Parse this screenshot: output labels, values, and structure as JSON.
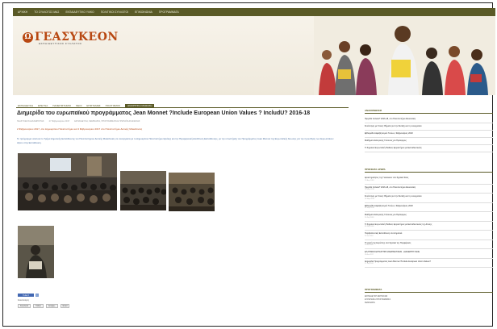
{
  "nav": {
    "items": [
      "ΑΡΧΙΚΗ",
      "ΤΟ ΣΥΛΛΟΓΟΣ ΜΑΣ",
      "ΕΚΠΑΙΔΕΥΤΙΚΟ ΥΛΙΚΟ",
      "ΠΟΛΙΤΙΚΟΙ ΣΥΛΛΟΓΟΙ",
      "ΕΠΙΚΟΙΝΩΝΙΑ",
      "ΠΡΟΓΡΑΜΜΑΤΑ"
    ]
  },
  "header": {
    "logo_mark": "Ω",
    "logo_name": "ΓΕΑΣΥΚΕΟΝ",
    "logo_tagline": "ΕΚΠΑΙΔΕΥΤΙΚΟΣ ΣΥΛΛΟΓΟΣ"
  },
  "tabs": [
    "ΕΚΠΑΙΔΕΥΣΗ",
    "ΕΡΕΥΝΑ",
    "ΠΑΝΕΠΙΣΤΗΜΙΟ",
    "ΝΕΟΙ",
    "ΕΠΙΣΤΗΜΕΣ",
    "ΠΟΛΙΤΙΣΜΟΣ",
    "ΔΙΑΚΡΙΤΙΚΗ ΜΑΘΗΣΗ"
  ],
  "article": {
    "title": "Διημερίδα του ευρωπαϊκού προγράμματος Jean Monnet ?Include European Union Values ? IncludU? 2016-18",
    "meta_author": "ΓΕΑΣΥΚΕΟΝ ΔΙΑΧΕΙΡΙΣΤΗΣ",
    "meta_date": "27 Φεβρουαρίου 2017",
    "meta_category": "ΕΚΠΑΙΔΕΥΣΗ, ΣΕΜΙΝΑΡΙΑ, ΠΡΟΓΡΑΜΜΑΤΑ ΕΥΡΩΠΑΪΚΗΣ ΕΝΩΣΗΣ",
    "lead": "2 Φεβρουαρίου 2017, στο Δημοκρίτειο Πανεπιστήμιο και 3 Φεβρουαρίου 2017 στο Πανεπιστήμιο Δυτικής Μακεδονίας",
    "paragraph": "Το πρόγραμμα υλοποιεί το Τμήμα Δημοτικής Εκπαίδευσης του Πανεπιστημίου Δυτικής Μακεδονίας σε συνεργασία με το Δημοκρίτειο Πανεπιστήμιο Θράκης και την Περιφερειακή Διεύθυνση Εκπαίδευσης, με την υποστήριξη του Προγράμματος Jean Monnet της Ευρωπαϊκής Ένωσης για την προώθηση των Ευρωπαϊκών Αξιών στην Εκπαίδευση."
  },
  "share": {
    "facebook_label": "f Like 0",
    "twitter_label": "t",
    "heading": "Κοινοποίηση:",
    "buttons": [
      "Facebook",
      "Twitter",
      "Google+",
      "Email"
    ]
  },
  "sidebar": {
    "recent_heading": "ΑΝΑΚΟΙΝΩΣΕΙΣ",
    "recent": [
      "Ημερίδα Include? 2016-18, στο Πανεπιστήμιο Θεσσαλίας",
      "Συνάντηση με Γονείς: Βήματα για την Ένταξη και τη συνεργασία",
      "Εβδομάδα Αλφαβητισμού Γονέων, Φεβρουάριος 2018",
      "Μαθήματα Ελληνικής Γλώσσας για Πρόσφυγες",
      "Τι Σημαίνει Ευρωπαϊκή Παιδεία; Εργαστήριο για Εκπαιδευτικούς"
    ],
    "latest_heading": "ΠΡΟΣΦΑΤΑ ΑΡΘΡΑ",
    "latest": [
      {
        "t": "Δραστηριότητες της Γεασυκεον στο Σχολικό Έτος",
        "d": "12 Απρ 2018"
      },
      {
        "t": "Ημερίδα Include? 2016-18, στο Πανεπιστήμιο Θεσσαλίας",
        "d": "28 Μαρ 2018"
      },
      {
        "t": "Συνάντηση με Γονείς: Βήματα για την Ένταξη και τη συνεργασία",
        "d": "14 Μαρ 2018"
      },
      {
        "t": "Εβδομάδα Αλφαβητισμού Γονέων, Φεβρουάριος 2018",
        "d": "02 Μαρ 2018"
      },
      {
        "t": "Μαθήματα Ελληνικής Γλώσσας για Πρόσφυγες",
        "d": "20 Φεβ 2018"
      },
      {
        "t": "Τι Σημαίνει Ευρωπαϊκή Παιδεία; Εργαστήριο για Εκπαιδευτικούς της Δ/νσης",
        "d": "05 Φεβ 2018"
      },
      {
        "t": "Περιβαλλοντική Εκπαίδευση στο Δημοτικό",
        "d": "22 Ιαν 2018"
      },
      {
        "t": "Η γιορτή της Ευρώπης στα Σχολεία της Περιφέρειας",
        "d": "10 Ιαν 2018"
      },
      {
        "t": "ΕΛΛΗΝΙΚΟ ΕΡΓΑΣΤΗΡΙ ΜΑΘΗΜΑΤΙΚΩΝ - ΔΙΑΚΕΡΠΗ ΠΑΙΔΙ",
        "d": "18 Δεκ 2017"
      },
      {
        "t": "Διημερίδα Προγράμματος Jean Monnet ?Include European Union Values?",
        "d": "27 Φεβ 2017"
      }
    ],
    "programs_heading": "ΠΡΟΓΡΑΜΜΑΤΑ",
    "programs": [
      "ΕΚΠΑΙΔΕΥΣΗ ΕΝΗΛΙΚΩΝ",
      "ΕΥΡΩΠΑΪΚΑ ΠΡΟΓΡΑΜΜΑΤΑ",
      "ΣΕΜΙΝΑΡΙΑ"
    ]
  }
}
